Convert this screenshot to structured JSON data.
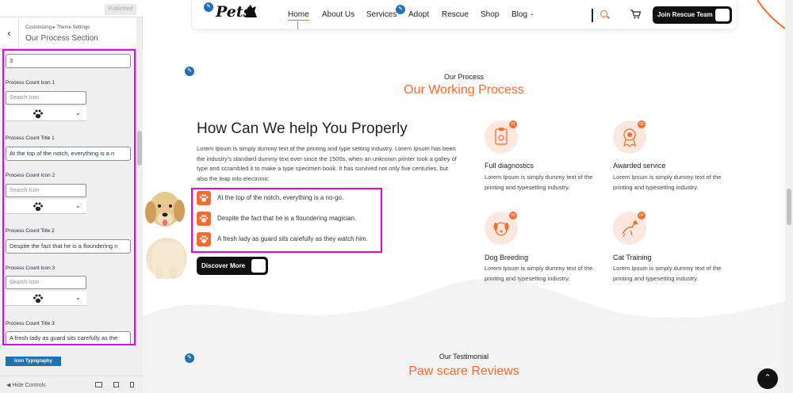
{
  "customizer": {
    "publish_label": "Published",
    "breadcrumb": "Customizing ▸ Theme Settings",
    "section_title": "Our Process Section",
    "count_value": "3",
    "controls": [
      {
        "icon_label": "Process Count Icon 1",
        "search_placeholder": "Search Icon",
        "title_label": "Process Count Title 1",
        "title_value": "At the top of the notch, everything is a n"
      },
      {
        "icon_label": "Process Count Icon 2",
        "search_placeholder": "Search Icon",
        "title_label": "Process Count Title 2",
        "title_value": "Despite the fact that he is a floundering n"
      },
      {
        "icon_label": "Process Count Icon 3",
        "search_placeholder": "Search Icon",
        "title_label": "Process Count Title 3",
        "title_value": "A fresh lady as guard sits carefully as the"
      }
    ],
    "typography_button": "Icon Typography",
    "hide_controls": "Hide Controls"
  },
  "header": {
    "logo": "Pets",
    "nav": [
      "Home",
      "About Us",
      "Services",
      "Adopt",
      "Rescue",
      "Shop",
      "Blog"
    ],
    "cta": "Join Rescue Team"
  },
  "process": {
    "eyebrow": "Our Process",
    "heading": "Our Working Process",
    "title": "How Can We help You Properly",
    "paragraph": "Lorem Ipsum is simply dummy text of the printing and type setting industry. Lorem Ipsum has been the industry's standard dummy text ever since the 1500s, when an unknown printer took a galley of type and scrambled it to make a type specimen book. It has survived not only five centuries, but also the leap into electronic",
    "list": [
      "At the top of the notch, everything is a no-go.",
      "Despite the fact that he is a floundering magician.",
      "A fresh lady as guard sits carefully as they watch him."
    ],
    "button": "Discover More",
    "services": [
      {
        "num": "01",
        "title": "Full diagnostics",
        "desc": "Lorem Ipsum is simply dummy text of the printing and typesetting industry.",
        "icon": "clipboard-pet-icon"
      },
      {
        "num": "02",
        "title": "Awarded service",
        "desc": "Lorem Ipsum is simply dummy text of the printing and typesetting industry.",
        "icon": "award-medal-icon"
      },
      {
        "num": "03",
        "title": "Dog Breeding",
        "desc": "Lorem Ipsum is simply dummy text of the printing and typesetting industry.",
        "icon": "dog-face-icon"
      },
      {
        "num": "04",
        "title": "Cat Training",
        "desc": "Lorem Ipsum is simply dummy text of the printing and typesetting industry.",
        "icon": "cat-jump-icon"
      }
    ]
  },
  "testimonial": {
    "eyebrow": "Our Testimonial",
    "heading": "Paw scare Reviews"
  },
  "colors": {
    "accent": "#ff6b2c",
    "highlight": "#e600e6",
    "wp_blue": "#2271b1"
  }
}
